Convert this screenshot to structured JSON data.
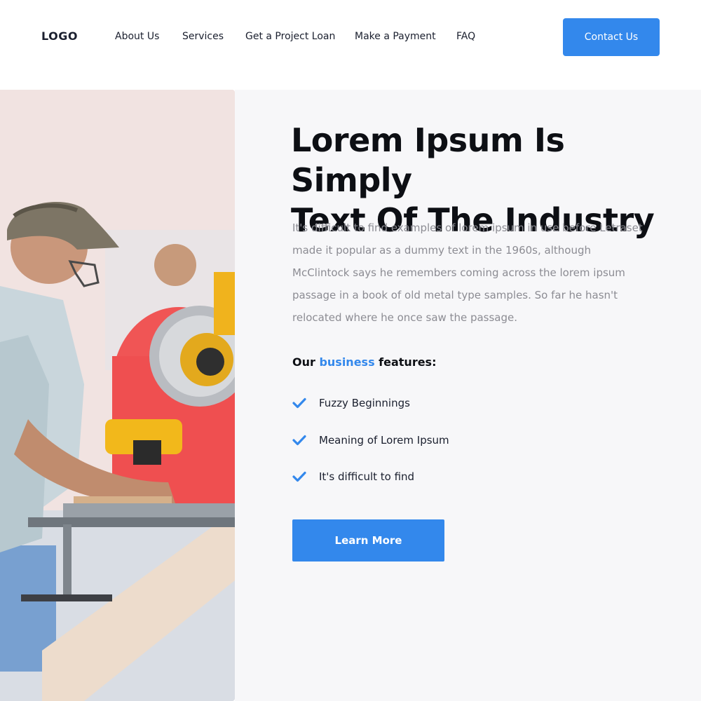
{
  "header": {
    "logo": "LOGO",
    "nav": [
      {
        "label": "About Us"
      },
      {
        "label": "Services"
      },
      {
        "label": "Get a Project Loan"
      },
      {
        "label": "Make a Payment"
      },
      {
        "label": "FAQ"
      }
    ],
    "contact_label": "Contact Us"
  },
  "hero": {
    "headline_line1": "Lorem Ipsum Is Simply",
    "headline_line2": "Text Of The Industry",
    "paragraph": "It's difficult to find examples of lorem ipsum in use before Letraset made it popular as a dummy text in the 1960s, although McClintock says he remembers coming across the lorem ipsum passage in a book of old metal type samples. So far he hasn't relocated where he once saw the passage.",
    "features_heading": {
      "before": "Our ",
      "accent": "business",
      "after": " features:"
    },
    "features": [
      {
        "label": "Fuzzy Beginnings",
        "icon": "check-icon"
      },
      {
        "label": "Meaning of Lorem Ipsum",
        "icon": "check-icon"
      },
      {
        "label": "It's difficult to find",
        "icon": "check-icon"
      }
    ],
    "cta_label": "Learn More"
  },
  "colors": {
    "accent": "#3388ec",
    "panel_background": "#f7f7f9",
    "text_dark": "#0d0f14",
    "text_muted": "#8c8c93"
  }
}
